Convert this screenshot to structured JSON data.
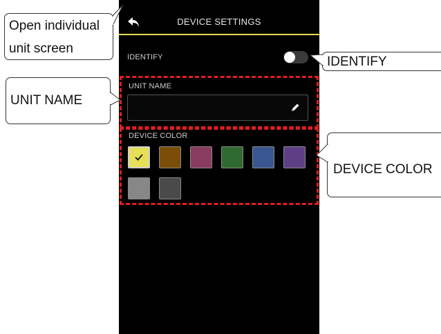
{
  "screen": {
    "title": "DEVICE SETTINGS",
    "identify_label": "IDENTIFY",
    "identify_on": false,
    "unit_name_label": "UNIT NAME",
    "unit_name_value": "",
    "device_color_label": "DEVICE COLOR",
    "colors": [
      {
        "name": "yellow",
        "hex": "#e6df58",
        "selected": true
      },
      {
        "name": "orange",
        "hex": "#7a4d08",
        "selected": false
      },
      {
        "name": "magenta",
        "hex": "#8a3c5e",
        "selected": false
      },
      {
        "name": "green",
        "hex": "#2f6a32",
        "selected": false
      },
      {
        "name": "blue",
        "hex": "#3a5690",
        "selected": false
      },
      {
        "name": "purple",
        "hex": "#5e3f86",
        "selected": false
      },
      {
        "name": "light-gray",
        "hex": "#878787",
        "selected": false
      },
      {
        "name": "dark-gray",
        "hex": "#4a4a4a",
        "selected": false
      }
    ]
  },
  "callouts": {
    "open_unit_line1": "Open individual",
    "open_unit_line2": "unit screen",
    "identify": "IDENTIFY",
    "unit_name": "UNIT NAME",
    "device_color": "DEVICE COLOR"
  },
  "accent": "#e5df55",
  "highlight": "#e21f1f"
}
